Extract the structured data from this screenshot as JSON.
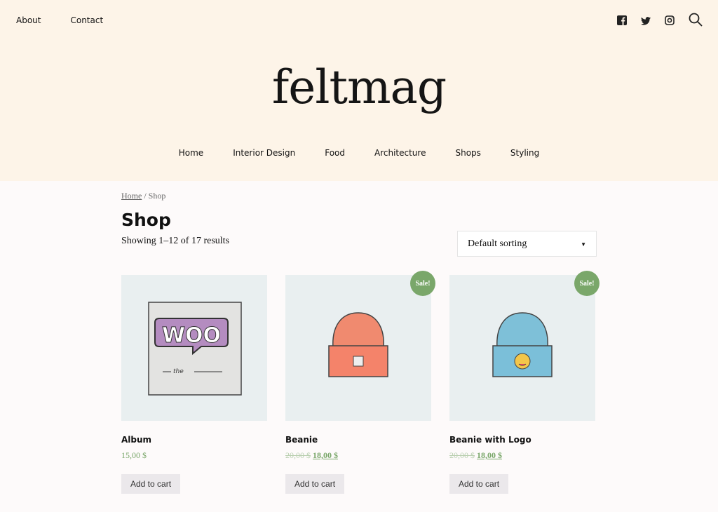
{
  "topnav": {
    "items": [
      "About",
      "Contact"
    ]
  },
  "social": [
    "facebook-icon",
    "twitter-icon",
    "instagram-icon",
    "search-icon"
  ],
  "site_title": "feltmag",
  "mainnav": {
    "items": [
      "Home",
      "Interior Design",
      "Food",
      "Architecture",
      "Shops",
      "Styling"
    ]
  },
  "breadcrumb": {
    "home": "Home",
    "separator": " / ",
    "current": "Shop"
  },
  "page_title": "Shop",
  "result_count": "Showing 1–12 of 17 results",
  "sorting": {
    "selected": "Default sorting"
  },
  "colors": {
    "accent": "#7aa76a",
    "header_bg": "#fdf4e8"
  },
  "products": [
    {
      "title": "Album",
      "price": "15,00 $",
      "sale": false,
      "button": "Add to cart"
    },
    {
      "title": "Beanie",
      "old_price": "20,00 $",
      "price": "18,00 $",
      "sale": true,
      "badge": "Sale!",
      "button": "Add to cart"
    },
    {
      "title": "Beanie with Logo",
      "old_price": "20,00 $",
      "price": "18,00 $",
      "sale": true,
      "badge": "Sale!",
      "button": "Add to cart"
    }
  ]
}
